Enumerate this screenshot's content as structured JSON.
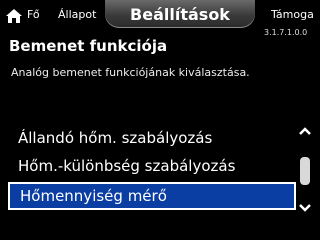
{
  "header": {
    "home_label": "Fő",
    "status_label": "Állapot",
    "settings_label": "Beállítások",
    "support_label": "Támoga",
    "version": "3.1.7.1.0.0"
  },
  "page": {
    "title": "Bemenet funkciója",
    "description": "Analóg bemenet funkciójának kiválasztása."
  },
  "options": [
    {
      "label": "Állandó hőm. szabályozás",
      "selected": false
    },
    {
      "label": "Hőm.-különbség szabályozás",
      "selected": false
    },
    {
      "label": "Hőmennyiség mérő",
      "selected": true
    }
  ],
  "icons": {
    "home": "home-icon",
    "up": "chevron-up-icon",
    "down": "chevron-down-icon"
  },
  "colors": {
    "background": "#000000",
    "selection": "#0b3ea3"
  }
}
